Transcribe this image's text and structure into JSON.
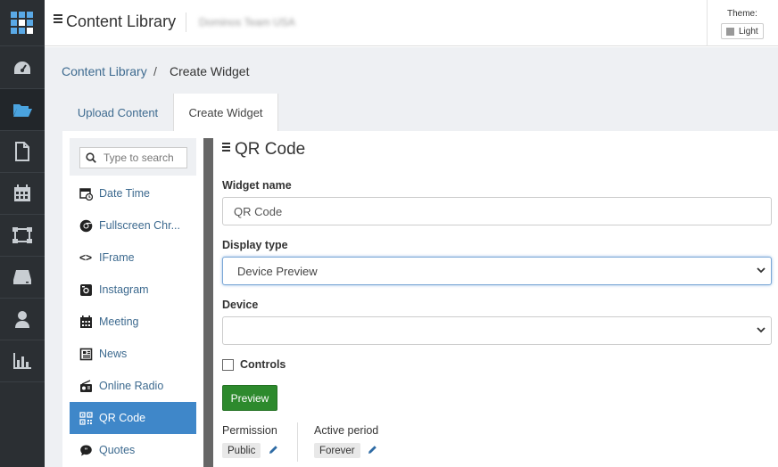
{
  "header": {
    "app_title": "Content Library",
    "team_name": "Dominos Team USA",
    "theme_label": "Theme:",
    "theme_value": "Light"
  },
  "nav": {
    "items": [
      "dashboard-icon",
      "folder-open-icon",
      "file-icon",
      "calendar-icon",
      "network-icon",
      "drive-icon",
      "user-icon",
      "bar-chart-icon"
    ],
    "active": "folder-open-icon"
  },
  "breadcrumb": {
    "root": "Content Library",
    "separator": "/",
    "current": "Create Widget"
  },
  "tabs": {
    "upload": "Upload Content",
    "create": "Create Widget",
    "active": "Create Widget"
  },
  "widget_list": {
    "search_placeholder": "Type to search",
    "items": [
      {
        "label": "Date Time",
        "icon": "calendar-clock-icon"
      },
      {
        "label": "Fullscreen Chr...",
        "icon": "chrome-icon"
      },
      {
        "label": "IFrame",
        "icon": "code-icon"
      },
      {
        "label": "Instagram",
        "icon": "instagram-icon"
      },
      {
        "label": "Meeting",
        "icon": "calendar-icon"
      },
      {
        "label": "News",
        "icon": "newspaper-icon"
      },
      {
        "label": "Online Radio",
        "icon": "radio-icon"
      },
      {
        "label": "QR Code",
        "icon": "qr-code-icon"
      },
      {
        "label": "Quotes",
        "icon": "quote-bubble-icon"
      }
    ],
    "selected": "QR Code"
  },
  "form": {
    "title": "QR Code",
    "widget_name_label": "Widget name",
    "widget_name_value": "QR Code",
    "display_type_label": "Display type",
    "display_type_value": "Device Preview",
    "device_label": "Device",
    "device_value": "",
    "controls_label": "Controls",
    "controls_checked": false,
    "preview_button": "Preview",
    "permission_label": "Permission",
    "permission_value": "Public",
    "active_period_label": "Active period",
    "active_period_value": "Forever"
  },
  "colors": {
    "nav_bg": "#2b2f33",
    "link": "#3d6a8f",
    "selected_item": "#3f87c9",
    "preview_button": "#2d8a2d",
    "page_bg": "#eef0f3"
  }
}
